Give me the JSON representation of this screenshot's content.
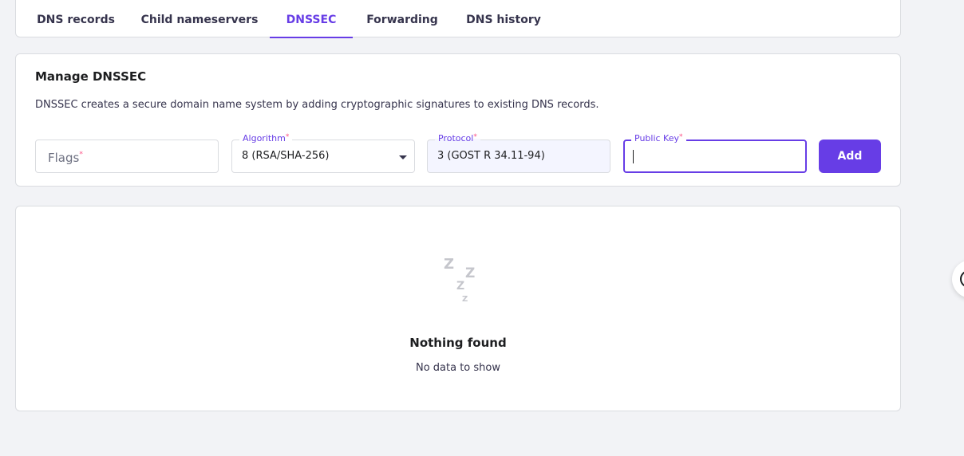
{
  "tabs": [
    {
      "label": "DNS records",
      "active": false
    },
    {
      "label": "Child nameservers",
      "active": false
    },
    {
      "label": "DNSSEC",
      "active": true
    },
    {
      "label": "Forwarding",
      "active": false
    },
    {
      "label": "DNS history",
      "active": false
    }
  ],
  "manage": {
    "title": "Manage DNSSEC",
    "description": "DNSSEC creates a secure domain name system by adding cryptographic signatures to existing DNS records.",
    "fields": {
      "flags": {
        "placeholder": "Flags",
        "required_mark": "*"
      },
      "algorithm": {
        "label": "Algorithm",
        "required_mark": "*",
        "value": "8 (RSA/SHA-256)"
      },
      "protocol": {
        "label": "Protocol",
        "required_mark": "*",
        "value": "3 (GOST R 34.11-94)"
      },
      "public_key": {
        "label": "Public Key",
        "required_mark": "*",
        "value": ""
      }
    },
    "add_label": "Add"
  },
  "empty_state": {
    "icon": "zzz-sleep-icon",
    "title": "Nothing found",
    "subtitle": "No data to show"
  },
  "colors": {
    "accent": "#673de6",
    "required": "#fc5185",
    "background": "#f2f3f6"
  }
}
